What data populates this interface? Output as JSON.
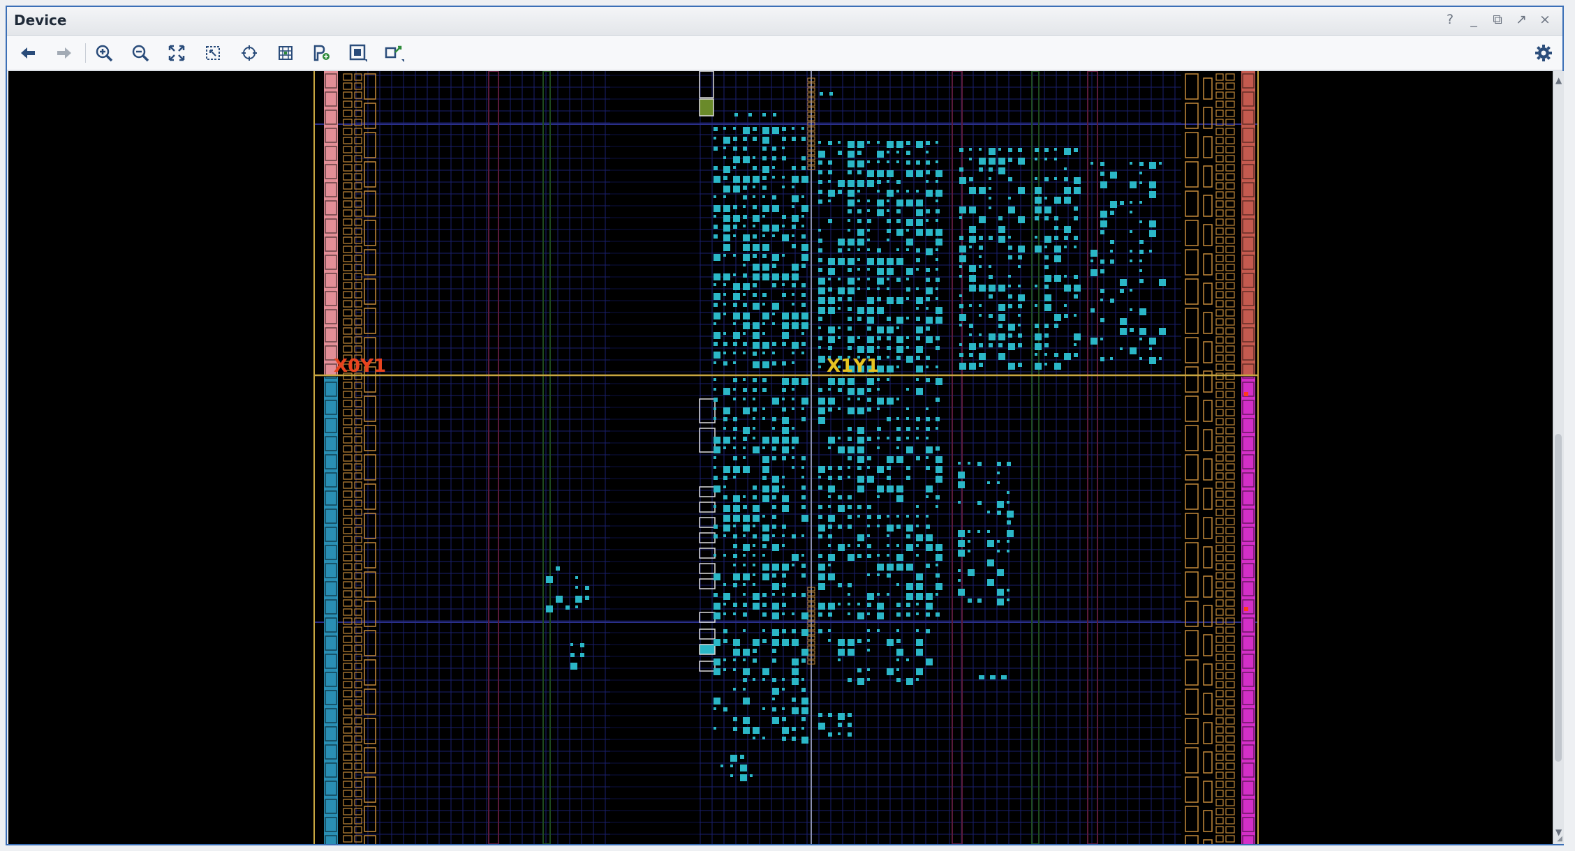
{
  "window": {
    "title": "Device",
    "controls": {
      "help": "?",
      "minimize": "_",
      "restore": "⧉",
      "maximize": "↗",
      "close": "×"
    }
  },
  "toolbar": {
    "buttons": [
      {
        "name": "back",
        "icon": "arrow-left-icon",
        "enabled": true
      },
      {
        "name": "forward",
        "icon": "arrow-right-icon",
        "enabled": false
      },
      {
        "name": "zoom-in",
        "icon": "zoom-in-icon",
        "enabled": true
      },
      {
        "name": "zoom-out",
        "icon": "zoom-out-icon",
        "enabled": true
      },
      {
        "name": "zoom-fit",
        "icon": "fit-icon",
        "enabled": true
      },
      {
        "name": "zoom-selected",
        "icon": "zoom-selected-icon",
        "enabled": true
      },
      {
        "name": "auto-fit-selection",
        "icon": "crosshair-icon",
        "enabled": true
      },
      {
        "name": "routing-resources",
        "icon": "routing-icon",
        "enabled": true
      },
      {
        "name": "create-pblock",
        "icon": "pblock-icon",
        "enabled": true
      },
      {
        "name": "select-area",
        "icon": "select-area-icon",
        "enabled": true
      },
      {
        "name": "draw-box",
        "icon": "draw-box-icon",
        "enabled": true
      }
    ],
    "settings_icon": "gear-icon"
  },
  "device_view": {
    "clock_regions": [
      {
        "label": "X0Y1",
        "color": "#e8431f"
      },
      {
        "label": "X1Y1",
        "color": "#e6c322"
      }
    ],
    "colors": {
      "background": "#000000",
      "grid": "#1a1f6e",
      "placed_cell": "#2bb7c7",
      "io_column_upper": "#e38f97",
      "io_column_lower": "#2a8fb4",
      "io_column_right_upper": "#c45a4f",
      "io_column_right_lower": "#d32fc7",
      "region_boundary": "#c8a640",
      "clock_spine": "#c58a3a"
    }
  }
}
